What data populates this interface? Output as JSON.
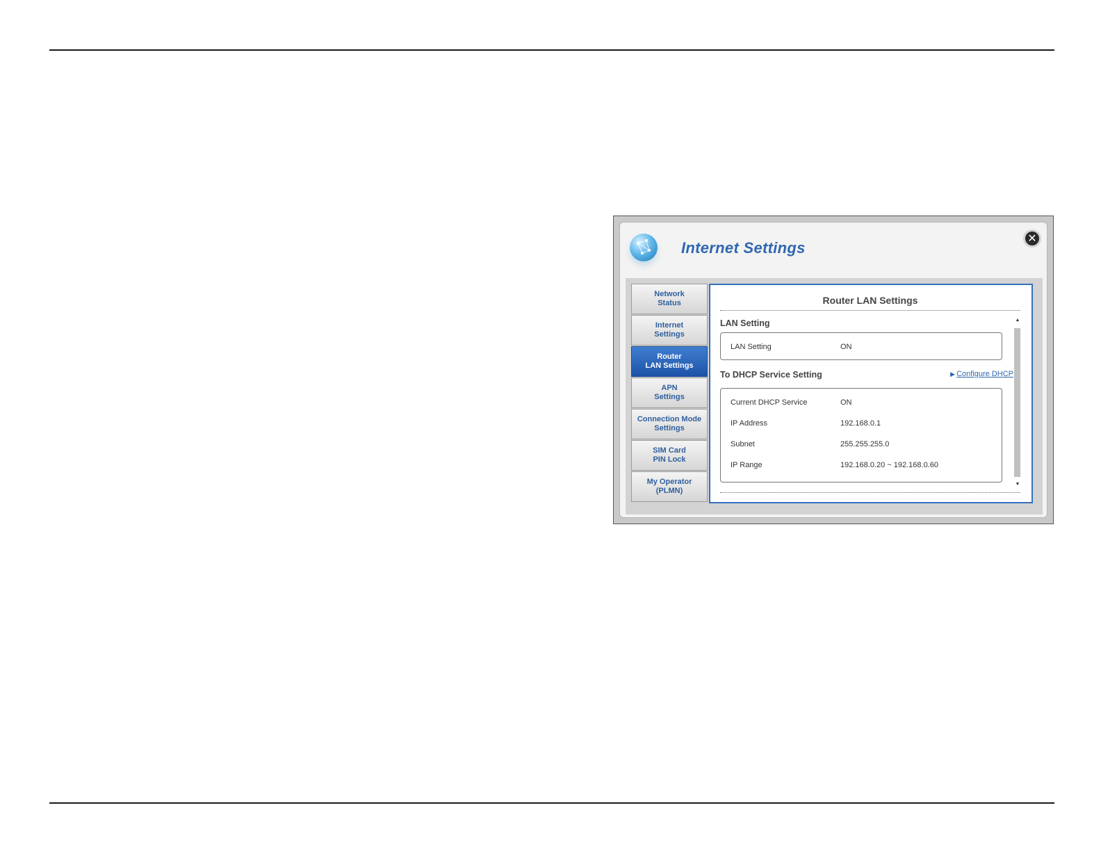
{
  "dialog": {
    "title": "Internet Settings",
    "close_glyph": "✕",
    "icons": {
      "app": "globe-network-icon",
      "close": "close-icon"
    }
  },
  "nav": {
    "items": [
      {
        "line1": "Network",
        "line2": "Status",
        "active": false
      },
      {
        "line1": "Internet",
        "line2": "Settings",
        "active": false
      },
      {
        "line1": "Router",
        "line2": "LAN Settings",
        "active": true
      },
      {
        "line1": "APN",
        "line2": "Settings",
        "active": false
      },
      {
        "line1": "Connection Mode",
        "line2": "Settings",
        "active": false
      },
      {
        "line1": "SIM Card",
        "line2": "PIN Lock",
        "active": false
      },
      {
        "line1": "My Operator",
        "line2": "(PLMN)",
        "active": false
      }
    ]
  },
  "content": {
    "title": "Router LAN Settings",
    "lan_section": {
      "heading": "LAN Setting",
      "rows": [
        {
          "label": "LAN Setting",
          "value": "ON"
        }
      ]
    },
    "dhcp_section": {
      "heading": "To DHCP Service Setting",
      "link": "Configure DHCP",
      "rows": [
        {
          "label": "Current DHCP Service",
          "value": "ON"
        },
        {
          "label": "IP Address",
          "value": "192.168.0.1"
        },
        {
          "label": "Subnet",
          "value": "255.255.255.0"
        },
        {
          "label": "IP Range",
          "value": "192.168.0.20 ~ 192.168.0.60"
        }
      ]
    }
  },
  "colors": {
    "accent": "#2f67b1",
    "active_nav": "#1d54a8",
    "frame": "#3570bd"
  }
}
